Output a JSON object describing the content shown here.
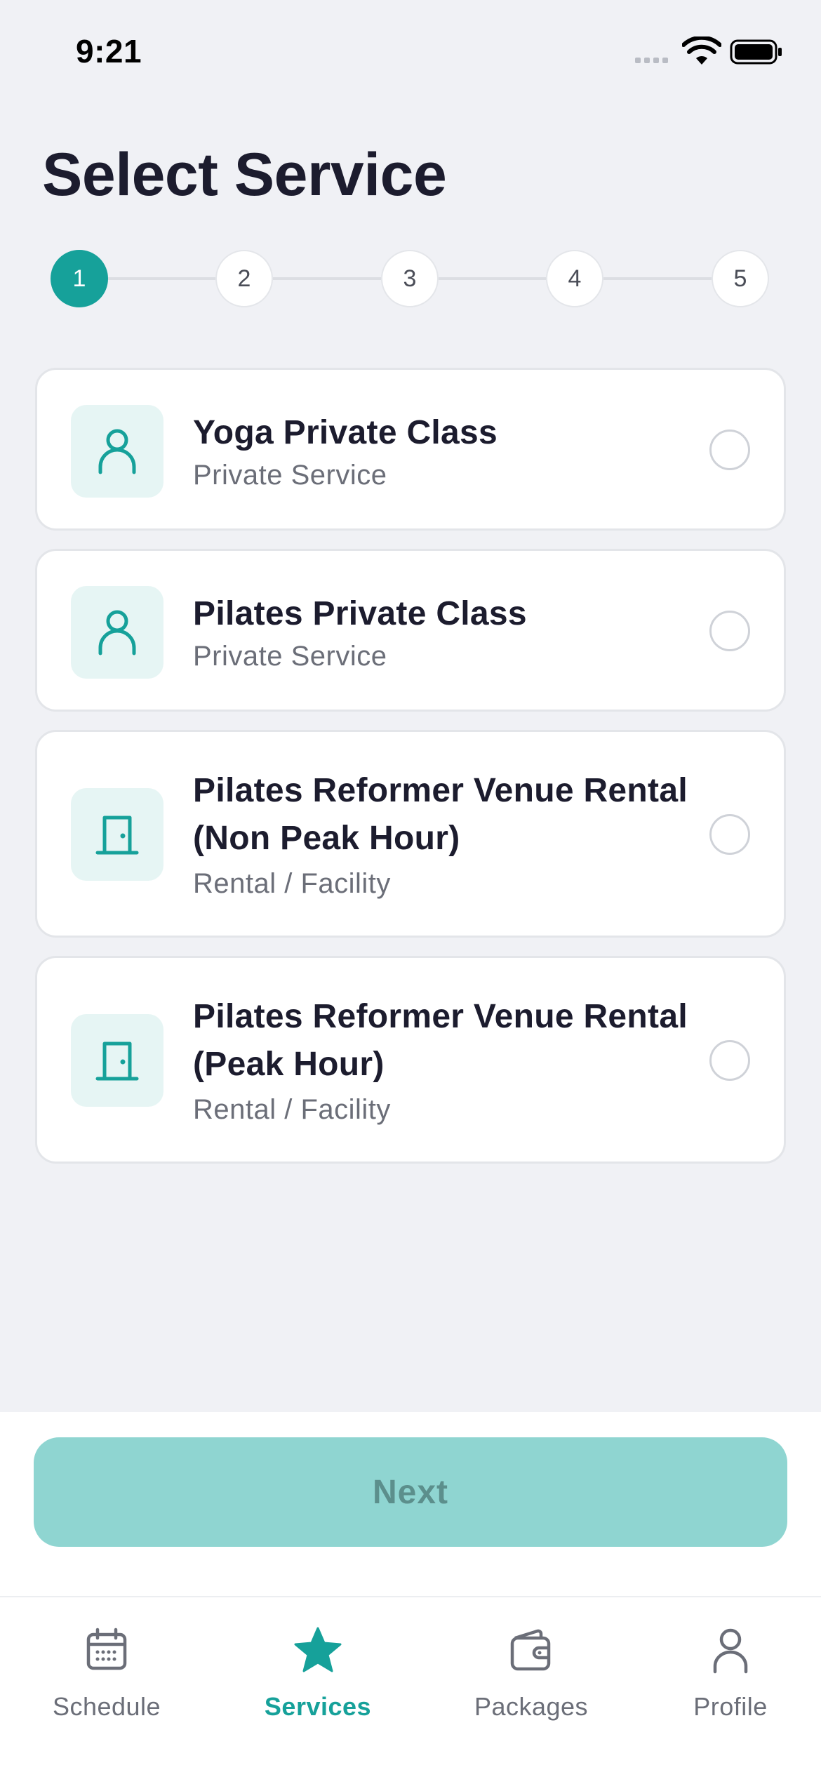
{
  "status_bar": {
    "time": "9:21"
  },
  "header": {
    "title": "Select Service"
  },
  "stepper": {
    "steps": [
      "1",
      "2",
      "3",
      "4",
      "5"
    ],
    "current_step": 1
  },
  "services": [
    {
      "title": "Yoga Private Class",
      "subtitle": "Private Service",
      "icon": "person-icon",
      "selected": false
    },
    {
      "title": "Pilates Private Class",
      "subtitle": "Private Service",
      "icon": "person-icon",
      "selected": false
    },
    {
      "title": "Pilates Reformer Venue Rental (Non Peak Hour)",
      "subtitle": "Rental / Facility",
      "icon": "door-icon",
      "selected": false
    },
    {
      "title": "Pilates Reformer Venue Rental (Peak Hour)",
      "subtitle": "Rental / Facility",
      "icon": "door-icon",
      "selected": false
    }
  ],
  "actions": {
    "next_label": "Next",
    "next_enabled": false
  },
  "tab_bar": {
    "items": [
      {
        "label": "Schedule",
        "icon": "calendar-icon",
        "active": false
      },
      {
        "label": "Services",
        "icon": "star-icon",
        "active": true
      },
      {
        "label": "Packages",
        "icon": "wallet-icon",
        "active": false
      },
      {
        "label": "Profile",
        "icon": "person-icon",
        "active": false
      }
    ]
  },
  "colors": {
    "accent": "#16a19a",
    "accent_light": "#e6f5f4",
    "next_disabled": "#8fd5d1",
    "background": "#f0f1f5"
  }
}
